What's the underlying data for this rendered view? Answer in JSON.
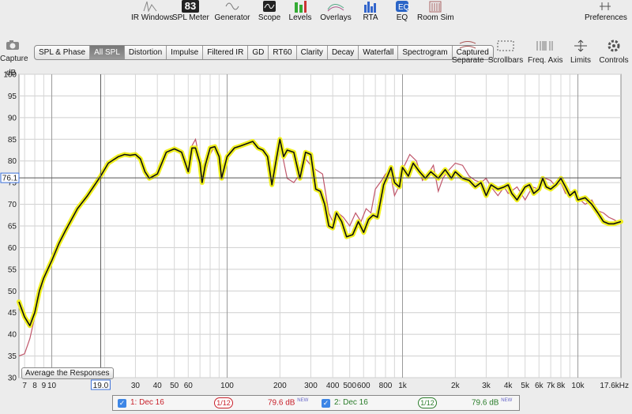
{
  "toolbar": {
    "items": [
      {
        "label": "IR Windows"
      },
      {
        "label": "SPL Meter",
        "value": "83"
      },
      {
        "label": "Generator"
      },
      {
        "label": "Scope"
      },
      {
        "label": "Levels"
      },
      {
        "label": "Overlays"
      },
      {
        "label": "RTA"
      },
      {
        "label": "EQ"
      },
      {
        "label": "Room Sim"
      },
      {
        "label": "Preferences"
      }
    ]
  },
  "capture_label": "Capture",
  "tabs": [
    "SPL & Phase",
    "All SPL",
    "Distortion",
    "Impulse",
    "Filtered IR",
    "GD",
    "RT60",
    "Clarity",
    "Decay",
    "Waterfall",
    "Spectrogram",
    "Captured"
  ],
  "active_tab": "All SPL",
  "right_tools": [
    "Separate",
    "Scrollbars",
    "Freq. Axis",
    "Limits",
    "Controls"
  ],
  "average_button": "Average the Responses",
  "legend": {
    "m1": {
      "label": "1: Dec 16",
      "smoothing": "1/12",
      "level": "79.6 dB",
      "new": "NEW",
      "color": "#c8202a"
    },
    "m2": {
      "label": "2: Dec 16",
      "smoothing": "1/12",
      "level": "79.6 dB",
      "new": "NEW",
      "color": "#2b7d2b"
    }
  },
  "chart_data": {
    "type": "line",
    "ylabel": "dB",
    "ylim": [
      30,
      100
    ],
    "xlim": [
      6.5,
      17600
    ],
    "x_scale": "log",
    "y_ticks": [
      30,
      35,
      40,
      45,
      50,
      55,
      60,
      65,
      70,
      75,
      80,
      85,
      90,
      95,
      100
    ],
    "x_ticks": [
      "7",
      "8",
      "9",
      "10",
      "19.0",
      "30",
      "40",
      "50",
      "60",
      "100",
      "200",
      "300",
      "400",
      "500",
      "600",
      "800",
      "1k",
      "2k",
      "3k",
      "4k",
      "5k",
      "6k",
      "7k",
      "8k",
      "10k",
      "17.6kHz"
    ],
    "cursor_x_label": "19.0",
    "cursor_y_label": "76.1",
    "cursor_x": 19.0,
    "cursor_y": 76.1,
    "series": [
      {
        "name": "1: Dec 16",
        "color": "#c0566a",
        "points": [
          [
            6.5,
            35
          ],
          [
            7,
            35.5
          ],
          [
            7.5,
            39
          ],
          [
            8,
            44
          ],
          [
            8.5,
            49
          ],
          [
            9,
            52
          ],
          [
            10,
            57
          ],
          [
            11,
            61
          ],
          [
            12,
            64
          ],
          [
            14,
            69
          ],
          [
            16,
            72
          ],
          [
            19,
            76.5
          ],
          [
            21,
            79.5
          ],
          [
            24,
            81
          ],
          [
            26,
            81.5
          ],
          [
            28,
            81.3
          ],
          [
            30,
            81.5
          ],
          [
            32,
            80.5
          ],
          [
            34,
            77.5
          ],
          [
            36,
            76
          ],
          [
            40,
            77
          ],
          [
            45,
            81.5
          ],
          [
            50,
            82.5
          ],
          [
            55,
            82
          ],
          [
            60,
            78
          ],
          [
            63,
            83.5
          ],
          [
            66,
            85
          ],
          [
            70,
            80
          ],
          [
            75,
            77
          ],
          [
            80,
            81.5
          ],
          [
            85,
            83.5
          ],
          [
            90,
            82
          ],
          [
            95,
            77
          ],
          [
            100,
            81
          ],
          [
            110,
            83
          ],
          [
            120,
            83.5
          ],
          [
            140,
            84
          ],
          [
            150,
            83
          ],
          [
            160,
            82.5
          ],
          [
            170,
            81
          ],
          [
            180,
            75
          ],
          [
            190,
            80
          ],
          [
            200,
            84.5
          ],
          [
            210,
            80
          ],
          [
            220,
            76
          ],
          [
            240,
            75
          ],
          [
            260,
            77
          ],
          [
            280,
            80.5
          ],
          [
            300,
            79
          ],
          [
            320,
            78
          ],
          [
            350,
            77
          ],
          [
            380,
            68
          ],
          [
            400,
            66
          ],
          [
            430,
            68
          ],
          [
            460,
            67
          ],
          [
            500,
            65
          ],
          [
            540,
            68
          ],
          [
            580,
            66
          ],
          [
            620,
            69
          ],
          [
            660,
            68
          ],
          [
            700,
            73.5
          ],
          [
            760,
            75.5
          ],
          [
            800,
            77
          ],
          [
            850,
            77.5
          ],
          [
            900,
            72
          ],
          [
            950,
            74
          ],
          [
            1000,
            78
          ],
          [
            1100,
            81.5
          ],
          [
            1200,
            80
          ],
          [
            1300,
            75.5
          ],
          [
            1400,
            77
          ],
          [
            1500,
            79
          ],
          [
            1600,
            73
          ],
          [
            1700,
            76
          ],
          [
            1800,
            77.5
          ],
          [
            2000,
            79.5
          ],
          [
            2200,
            79
          ],
          [
            2400,
            76.5
          ],
          [
            2600,
            75.5
          ],
          [
            2800,
            75
          ],
          [
            3000,
            76
          ],
          [
            3200,
            74
          ],
          [
            3500,
            72
          ],
          [
            3800,
            74
          ],
          [
            4000,
            72.5
          ],
          [
            4500,
            74
          ],
          [
            5000,
            71
          ],
          [
            5500,
            74
          ],
          [
            6000,
            73.5
          ],
          [
            6500,
            76
          ],
          [
            7000,
            75.5
          ],
          [
            7500,
            74
          ],
          [
            8000,
            75
          ],
          [
            8500,
            72.5
          ],
          [
            9000,
            73
          ],
          [
            10000,
            71.5
          ],
          [
            11000,
            70
          ],
          [
            12000,
            71
          ],
          [
            13000,
            68.5
          ],
          [
            14000,
            68
          ],
          [
            15000,
            67
          ],
          [
            16000,
            66.5
          ],
          [
            17600,
            65.5
          ]
        ]
      },
      {
        "name": "2: Dec 16",
        "color": "#111111",
        "highlight": "#f0f020",
        "points": [
          [
            6.5,
            47.5
          ],
          [
            7,
            44
          ],
          [
            7.5,
            42
          ],
          [
            8,
            45
          ],
          [
            8.5,
            50
          ],
          [
            9,
            53
          ],
          [
            10,
            57
          ],
          [
            11,
            61
          ],
          [
            12,
            64
          ],
          [
            14,
            69
          ],
          [
            16,
            72
          ],
          [
            19,
            76.5
          ],
          [
            21,
            79.5
          ],
          [
            24,
            81
          ],
          [
            26,
            81.5
          ],
          [
            28,
            81.3
          ],
          [
            30,
            81.5
          ],
          [
            32,
            80.5
          ],
          [
            34,
            77.5
          ],
          [
            36,
            76
          ],
          [
            40,
            77
          ],
          [
            45,
            82
          ],
          [
            50,
            82.8
          ],
          [
            55,
            82
          ],
          [
            60,
            77.5
          ],
          [
            63,
            83
          ],
          [
            66,
            83
          ],
          [
            70,
            79.5
          ],
          [
            72,
            75
          ],
          [
            75,
            79
          ],
          [
            80,
            83
          ],
          [
            85,
            83.3
          ],
          [
            90,
            81
          ],
          [
            93,
            76
          ],
          [
            100,
            81
          ],
          [
            110,
            83
          ],
          [
            120,
            83.5
          ],
          [
            140,
            84.5
          ],
          [
            150,
            83
          ],
          [
            160,
            82.5
          ],
          [
            170,
            81
          ],
          [
            180,
            74.5
          ],
          [
            190,
            80
          ],
          [
            200,
            85
          ],
          [
            210,
            81
          ],
          [
            220,
            82.5
          ],
          [
            240,
            82
          ],
          [
            260,
            76
          ],
          [
            280,
            82
          ],
          [
            300,
            81.5
          ],
          [
            320,
            73.5
          ],
          [
            340,
            73
          ],
          [
            360,
            70
          ],
          [
            380,
            65
          ],
          [
            400,
            64.5
          ],
          [
            420,
            68
          ],
          [
            450,
            66
          ],
          [
            480,
            62.5
          ],
          [
            520,
            63
          ],
          [
            560,
            66
          ],
          [
            600,
            63.5
          ],
          [
            640,
            66.5
          ],
          [
            680,
            67.5
          ],
          [
            720,
            67
          ],
          [
            780,
            74.5
          ],
          [
            820,
            76.5
          ],
          [
            860,
            78.5
          ],
          [
            900,
            75
          ],
          [
            960,
            74
          ],
          [
            1000,
            78.5
          ],
          [
            1080,
            76.5
          ],
          [
            1150,
            79.5
          ],
          [
            1250,
            77.5
          ],
          [
            1350,
            76
          ],
          [
            1450,
            77.5
          ],
          [
            1600,
            76
          ],
          [
            1750,
            78
          ],
          [
            1900,
            76
          ],
          [
            2000,
            77.5
          ],
          [
            2200,
            76
          ],
          [
            2400,
            75.5
          ],
          [
            2600,
            74
          ],
          [
            2800,
            75
          ],
          [
            3000,
            72
          ],
          [
            3200,
            74.5
          ],
          [
            3500,
            73.5
          ],
          [
            3800,
            74
          ],
          [
            4000,
            74.5
          ],
          [
            4200,
            72.5
          ],
          [
            4500,
            71
          ],
          [
            5000,
            74
          ],
          [
            5300,
            74.5
          ],
          [
            5600,
            72.5
          ],
          [
            6000,
            73.5
          ],
          [
            6300,
            76
          ],
          [
            6600,
            74
          ],
          [
            7000,
            73.5
          ],
          [
            7500,
            74.5
          ],
          [
            8000,
            76
          ],
          [
            8500,
            74
          ],
          [
            9000,
            72
          ],
          [
            9600,
            73
          ],
          [
            10000,
            71
          ],
          [
            11000,
            71.5
          ],
          [
            12000,
            70
          ],
          [
            13000,
            68
          ],
          [
            14000,
            66
          ],
          [
            15000,
            65.5
          ],
          [
            16000,
            65.5
          ],
          [
            17600,
            66
          ]
        ]
      }
    ]
  }
}
